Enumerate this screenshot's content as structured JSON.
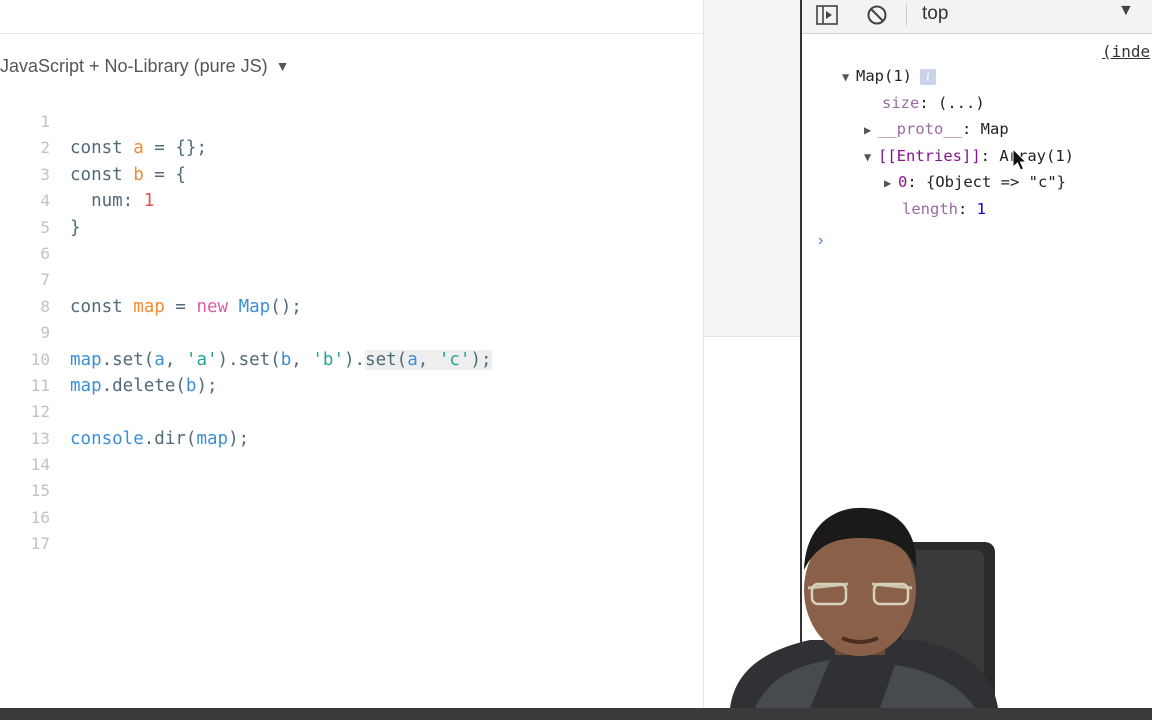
{
  "editor": {
    "language_label": "JavaScript + No-Library (pure JS)",
    "lines": [
      {
        "no": "1",
        "tokens": []
      },
      {
        "no": "2",
        "tokens": [
          {
            "t": "const ",
            "c": "kw"
          },
          {
            "t": "a",
            "c": "var"
          },
          {
            "t": " = {};",
            "c": "plain"
          }
        ]
      },
      {
        "no": "3",
        "tokens": [
          {
            "t": "const ",
            "c": "kw"
          },
          {
            "t": "b",
            "c": "var"
          },
          {
            "t": " = {",
            "c": "plain"
          }
        ]
      },
      {
        "no": "4",
        "tokens": [
          {
            "t": "  num: ",
            "c": "plain"
          },
          {
            "t": "1",
            "c": "num"
          }
        ]
      },
      {
        "no": "5",
        "tokens": [
          {
            "t": "}",
            "c": "plain"
          }
        ]
      },
      {
        "no": "6",
        "tokens": []
      },
      {
        "no": "7",
        "tokens": []
      },
      {
        "no": "8",
        "tokens": [
          {
            "t": "const ",
            "c": "kw"
          },
          {
            "t": "map",
            "c": "var"
          },
          {
            "t": " = ",
            "c": "plain"
          },
          {
            "t": "new ",
            "c": "new"
          },
          {
            "t": "Map",
            "c": "cls"
          },
          {
            "t": "();",
            "c": "plain"
          }
        ]
      },
      {
        "no": "9",
        "tokens": []
      },
      {
        "no": "10",
        "tokens": [
          {
            "t": "map",
            "c": "cls"
          },
          {
            "t": ".set(",
            "c": "plain"
          },
          {
            "t": "a",
            "c": "cls"
          },
          {
            "t": ", ",
            "c": "plain"
          },
          {
            "t": "'a'",
            "c": "str"
          },
          {
            "t": ").set(",
            "c": "plain"
          },
          {
            "t": "b",
            "c": "cls"
          },
          {
            "t": ", ",
            "c": "plain"
          },
          {
            "t": "'b'",
            "c": "str"
          },
          {
            "t": ").",
            "c": "plain"
          },
          {
            "t": "set(",
            "c": "plain",
            "hl": true
          },
          {
            "t": "a",
            "c": "cls",
            "hl": true
          },
          {
            "t": ", ",
            "c": "plain",
            "hl": true
          },
          {
            "t": "'c'",
            "c": "str",
            "hl": true
          },
          {
            "t": ");",
            "c": "plain",
            "hl": true
          }
        ]
      },
      {
        "no": "11",
        "tokens": [
          {
            "t": "map",
            "c": "cls"
          },
          {
            "t": ".delete(",
            "c": "plain"
          },
          {
            "t": "b",
            "c": "cls"
          },
          {
            "t": ");",
            "c": "plain"
          }
        ]
      },
      {
        "no": "12",
        "tokens": []
      },
      {
        "no": "13",
        "tokens": [
          {
            "t": "console",
            "c": "cls"
          },
          {
            "t": ".dir(",
            "c": "plain"
          },
          {
            "t": "map",
            "c": "cls"
          },
          {
            "t": ");",
            "c": "plain"
          }
        ]
      },
      {
        "no": "14",
        "tokens": []
      },
      {
        "no": "15",
        "tokens": []
      },
      {
        "no": "16",
        "tokens": []
      },
      {
        "no": "17",
        "tokens": []
      }
    ]
  },
  "devtools": {
    "context": "top",
    "source_link": "(inde",
    "map_label": "Map(1)",
    "size_key": "size",
    "size_value": "(...)",
    "proto_key": "__proto__",
    "proto_value": "Map",
    "entries_key": "[[Entries]]",
    "entries_value": "Array(1)",
    "entry_index": "0",
    "entry_value": "{Object => \"c\"}",
    "length_key": "length",
    "length_value": "1",
    "prompt": "›"
  },
  "colors": {
    "keyword": "#4f6b78",
    "variable": "#f28b32",
    "new": "#d95fa5",
    "number": "#e05252",
    "string": "#2aa198",
    "class": "#3b8fd6"
  }
}
